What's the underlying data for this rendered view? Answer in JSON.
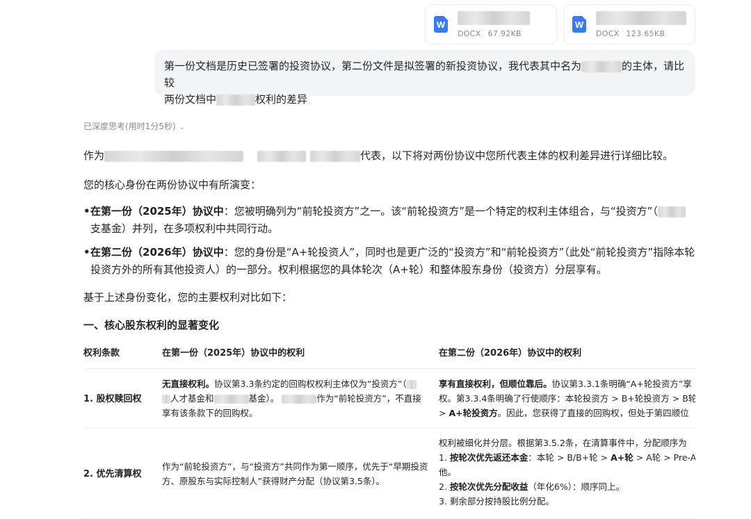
{
  "attachments": [
    {
      "type": "DOCX",
      "size": "67.92KB",
      "icon": "word-doc-icon"
    },
    {
      "type": "DOCX",
      "size": "123.65KB",
      "icon": "word-doc-icon"
    }
  ],
  "user_message": {
    "part1": "第一份文档是历史已签署的投资协议，第二份文件是拟签署的新投资协议，我代表其中名为",
    "part2": "的主体，请比较",
    "part3": "两份文档中",
    "part4": "权利的差异"
  },
  "thinking": {
    "label": "已深度思考(用时1分5秒)",
    "icon": "chevron-down-icon"
  },
  "answer": {
    "intro_prefix": "作为",
    "intro_suffix": "代表，以下将对两份协议中您所代表主体的权利差异进行详细比较。",
    "identity_line": "您的核心身份在两份协议中有所演变：",
    "bullet1_bold": "在第一份（2025年）协议中",
    "bullet1_text": "：您被明确列为“前轮投资方”之一。该“前轮投资方”是一个特定的权利主体组合，与“投资方”（",
    "bullet1_text2": "支基金）并列，在多项权利中共同行动。",
    "bullet2_bold": "在第二份（2026年）协议中",
    "bullet2_text": "：您的身份是“A+轮投资人”，同时也是更广泛的“投资方”和“前轮投资方”（此处“前轮投资方”指除本轮投资方外的所有其他投资人）的一部分。权利根据您的具体轮次（A+轮）和整体股东身份（投资方）分层享有。",
    "based_line": "基于上述身份变化，您的主要权利对比如下：",
    "section_heading": "一、核心股东权利的显著变化"
  },
  "table": {
    "headers": [
      "权利条款",
      "在第一份（2025年）协议中的权利",
      "在第二份（2026年）协议中的权利"
    ],
    "rows": [
      {
        "label": "1. 股权赎回权",
        "col2_bold": "无直接权利。",
        "col2_l1": "协议第3.3条约定的回购权权利主体仅为“投资方”（",
        "col2_l2a": "人才基金和",
        "col2_l2b": "基金）。",
        "col2_l2c": "作为“前轮投资方”，不直接",
        "col2_l3": "享有该条款下的回购权。",
        "col3_bold": "享有直接权利，但顺位靠后。",
        "col3_l1": "协议第3.3.1条明确“A+轮投资方”享",
        "col3_l2": "权。第3.3.4条明确了行使顺序：本轮投资方 > B+轮投资方 > B轮",
        "col3_l3a": "> ",
        "col3_l3b": "A+轮投资方",
        "col3_l3c": "。因此，您获得了直接的回购权，但处于第四顺位"
      },
      {
        "label": "2. 优先清算权",
        "col2_l1": "作为“前轮投资方”，与“投资方”共同作为第一顺序，优先于“早期投资",
        "col2_l2": "方、原股东与实际控制人”获得财产分配（协议第3.5条）。",
        "col3_l1": "权利被细化并分层。根据第3.5.2条，在清算事件中，分配顺序为",
        "col3_l2a": "1. ",
        "col3_l2b": "按轮次优先返还本金",
        "col3_l2c": "：本轮 > B/B+轮 > ",
        "col3_l2d": "A+轮",
        "col3_l2e": " > A轮 > Pre-A轮",
        "col3_l3": "他。",
        "col3_l4a": "2. ",
        "col3_l4b": "按轮次优先分配收益",
        "col3_l4c": "（年化6%）：顺序同上。",
        "col3_l5": "3. 剩余部分按持股比例分配。"
      }
    ]
  }
}
